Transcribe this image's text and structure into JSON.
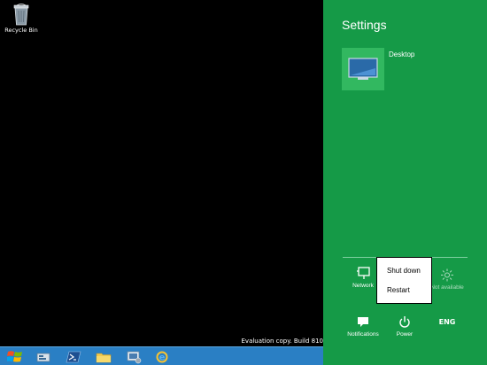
{
  "desktop": {
    "icons": [
      {
        "label": "Recycle Bin",
        "icon": "recycle-bin-icon"
      }
    ],
    "watermark": "Evaluation copy. Build 810"
  },
  "taskbar": {
    "items": [
      {
        "name": "start-button",
        "icon": "windows-logo-icon"
      },
      {
        "name": "server-manager",
        "icon": "server-manager-icon"
      },
      {
        "name": "powershell",
        "icon": "powershell-icon"
      },
      {
        "name": "file-explorer",
        "icon": "folder-icon"
      },
      {
        "name": "server-tools",
        "icon": "server-tools-icon"
      },
      {
        "name": "internet-explorer",
        "icon": "ie-icon"
      }
    ]
  },
  "settings": {
    "title": "Settings",
    "tile_label": "Desktop",
    "quick": {
      "network": "Network",
      "brightness": "Not available",
      "notifications": "Notifications",
      "power": "Power",
      "language": "ENG"
    },
    "accent": "#159a47"
  },
  "power_menu": {
    "shut_down": "Shut down",
    "restart": "Restart"
  }
}
